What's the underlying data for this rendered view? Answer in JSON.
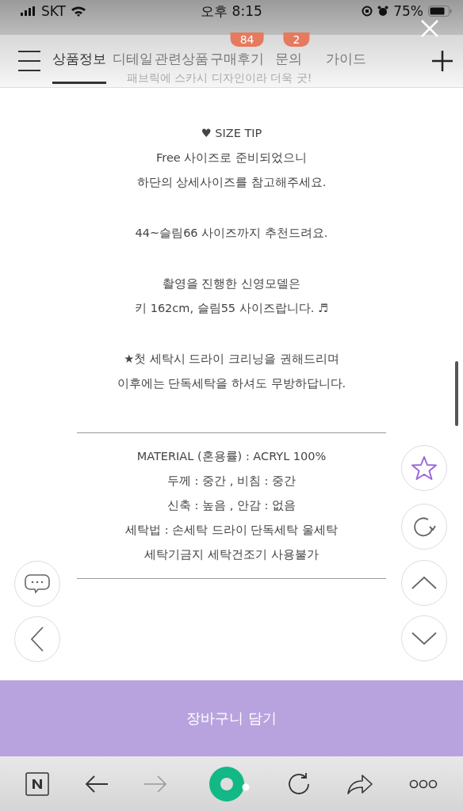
{
  "status_bar": {
    "carrier": "SKT",
    "time": "오후 8:15",
    "battery": "75%"
  },
  "nav": {
    "tabs": [
      {
        "label": "상품정보",
        "selected": true
      },
      {
        "label": "디테일",
        "selected": false
      },
      {
        "label": "관련상품",
        "selected": false
      },
      {
        "label": "구매후기",
        "selected": false,
        "badge": "84"
      },
      {
        "label": "문의",
        "selected": false,
        "badge": "2"
      },
      {
        "label": "가이드",
        "selected": false
      }
    ]
  },
  "behind_text": "패브릭에 스카시 디자인이라 더욱 굿!",
  "size_tip": {
    "heading": "♥ SIZE TIP",
    "paragraphs": [
      [
        "Free 사이즈로 준비되었으니",
        "하단의 상세사이즈를 참고해주세요."
      ],
      [
        "44~슬림66 사이즈까지 추천드려요."
      ],
      [
        "촬영을 진행한 신영모델은",
        "키 162cm, 슬림55 사이즈랍니다. ♬"
      ],
      [
        "★첫 세탁시 드라이 크리닝을 권해드리며",
        "이후에는 단독세탁을 하셔도 무방하답니다."
      ]
    ]
  },
  "material": [
    "MATERIAL (혼용률) : ACRYL 100%",
    "두께 : 중간 , 비침 : 중간",
    "신축 : 높음 , 안감 : 없음",
    "세탁법 : 손세탁 드라이 단독세탁 울세탁",
    "세탁기금지 세탁건조기 사용불가"
  ],
  "cart_button": "장바구니 담기"
}
